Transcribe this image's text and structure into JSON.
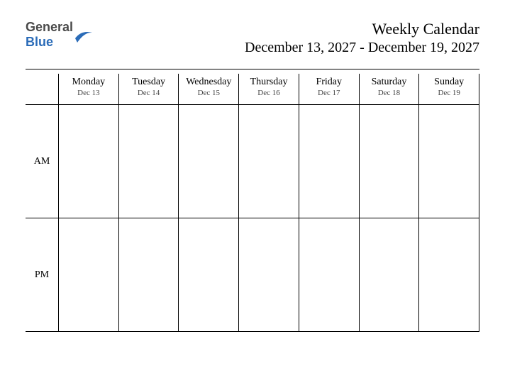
{
  "brand": {
    "part1": "General",
    "part2": "Blue"
  },
  "title": "Weekly Calendar",
  "subtitle": "December 13, 2027 - December 19, 2027",
  "periods": {
    "am": "AM",
    "pm": "PM"
  },
  "days": [
    {
      "name": "Monday",
      "date": "Dec 13"
    },
    {
      "name": "Tuesday",
      "date": "Dec 14"
    },
    {
      "name": "Wednesday",
      "date": "Dec 15"
    },
    {
      "name": "Thursday",
      "date": "Dec 16"
    },
    {
      "name": "Friday",
      "date": "Dec 17"
    },
    {
      "name": "Saturday",
      "date": "Dec 18"
    },
    {
      "name": "Sunday",
      "date": "Dec 19"
    }
  ]
}
